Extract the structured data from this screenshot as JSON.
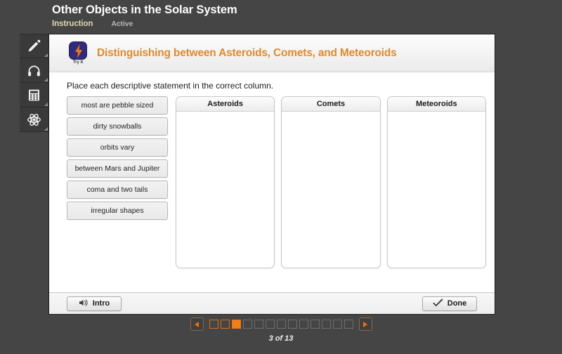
{
  "header": {
    "lesson_title": "Other Objects in the Solar System",
    "tabs": [
      {
        "label": "Instruction",
        "state": "selected"
      },
      {
        "label": "Active",
        "state": "normal"
      }
    ]
  },
  "tool_rail": {
    "items": [
      {
        "name": "pencil-icon",
        "label": "Pencil"
      },
      {
        "name": "headphones-icon",
        "label": "Headphones"
      },
      {
        "name": "calculator-icon",
        "label": "Calculator"
      },
      {
        "name": "atom-icon",
        "label": "Atom"
      }
    ]
  },
  "activity": {
    "badge_label": "Try It",
    "title": "Distinguishing between Asteroids, Comets, and Meteoroids",
    "instructions": "Place each descriptive statement in the correct column.",
    "statements": [
      {
        "text": "most are pebble sized"
      },
      {
        "text": "dirty snowballs"
      },
      {
        "text": "orbits vary"
      },
      {
        "text": "between Mars and Jupiter"
      },
      {
        "text": "coma and two tails"
      },
      {
        "text": "irregular shapes"
      }
    ],
    "columns": [
      {
        "title": "Asteroids",
        "items": []
      },
      {
        "title": "Comets",
        "items": []
      },
      {
        "title": "Meteoroids",
        "items": []
      }
    ]
  },
  "panel_footer": {
    "intro_label": "Intro",
    "done_label": "Done"
  },
  "pager": {
    "prev_label": "Previous",
    "next_label": "Next",
    "current_page": 3,
    "total_pages": 13,
    "page_count_text": "3 of 13",
    "dots": [
      "visited",
      "visited",
      "current",
      "unvisited",
      "unvisited",
      "unvisited",
      "unvisited",
      "unvisited",
      "unvisited",
      "unvisited",
      "unvisited",
      "unvisited",
      "unvisited"
    ]
  },
  "colors": {
    "background": "#454545",
    "accent_orange": "#e08a2e",
    "pager_orange": "#f07f1a",
    "tab_selected": "#ddd6b0",
    "badge_blue": "#312b7a"
  }
}
